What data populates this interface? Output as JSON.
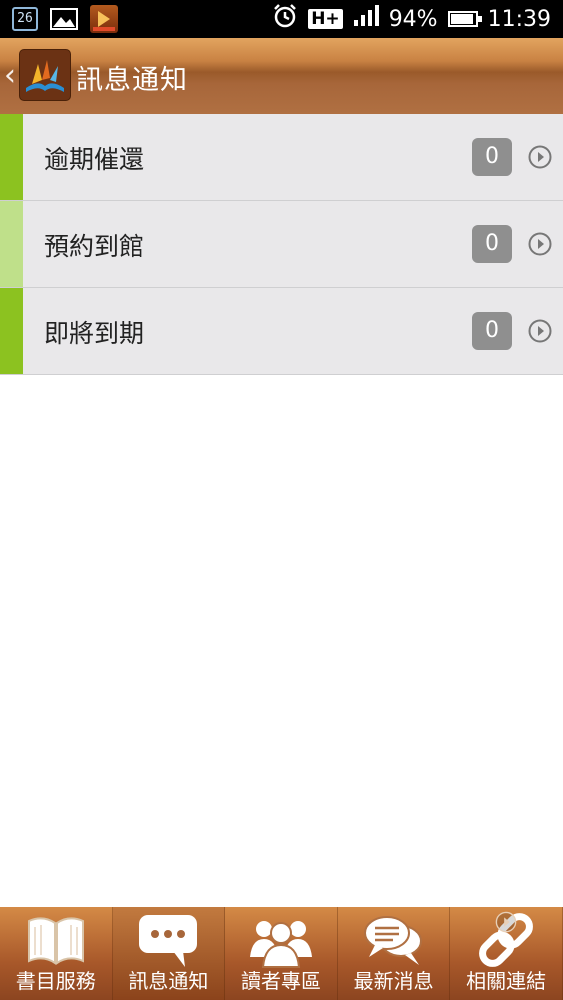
{
  "status_bar": {
    "calendar_day": "26",
    "network": "H+",
    "battery": "94%",
    "battery_level": 0.94,
    "time": "11:39",
    "icons": [
      "calendar-icon",
      "gallery-icon",
      "app-notification-icon",
      "alarm-icon",
      "signal-icon",
      "battery-icon"
    ]
  },
  "header": {
    "title": "訊息通知",
    "back_icon": "chevron-left-icon"
  },
  "notifications": [
    {
      "label": "逾期催還",
      "count": "0",
      "accent": "#8cc220"
    },
    {
      "label": "預約到館",
      "count": "0",
      "accent": "#bfe08a"
    },
    {
      "label": "即將到期",
      "count": "0",
      "accent": "#8cc220"
    }
  ],
  "bottom_nav": [
    {
      "label": "書目服務",
      "icon": "open-book-icon",
      "active": false
    },
    {
      "label": "訊息通知",
      "icon": "chat-bubble-icon",
      "active": true
    },
    {
      "label": "讀者專區",
      "icon": "people-icon",
      "active": false
    },
    {
      "label": "最新消息",
      "icon": "speech-bubbles-icon",
      "active": false
    },
    {
      "label": "相關連結",
      "icon": "link-icon",
      "active": false
    }
  ],
  "colors": {
    "header": "#a7663a",
    "row_bg": "#e9e8ea",
    "badge": "#8f8f8f"
  }
}
